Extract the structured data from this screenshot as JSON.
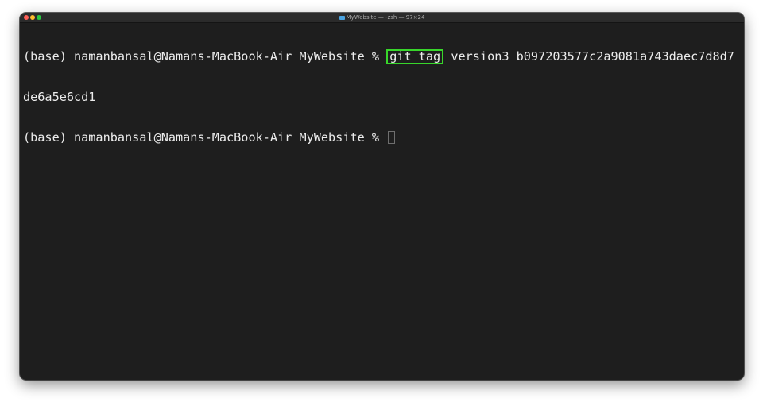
{
  "window": {
    "title": "MyWebsite — -zsh — 97×24"
  },
  "terminal": {
    "prompt": "(base) namanbansal@Namans-MacBook-Air MyWebsite % ",
    "command": "git tag",
    "output_line1_tail": " version3 b097203577c2a9081a743daec7d8d7",
    "output_line2": "de6a5e6cd1"
  },
  "colors": {
    "highlight": "#38d62b",
    "background": "#1e1e1e",
    "text": "#ececec"
  }
}
